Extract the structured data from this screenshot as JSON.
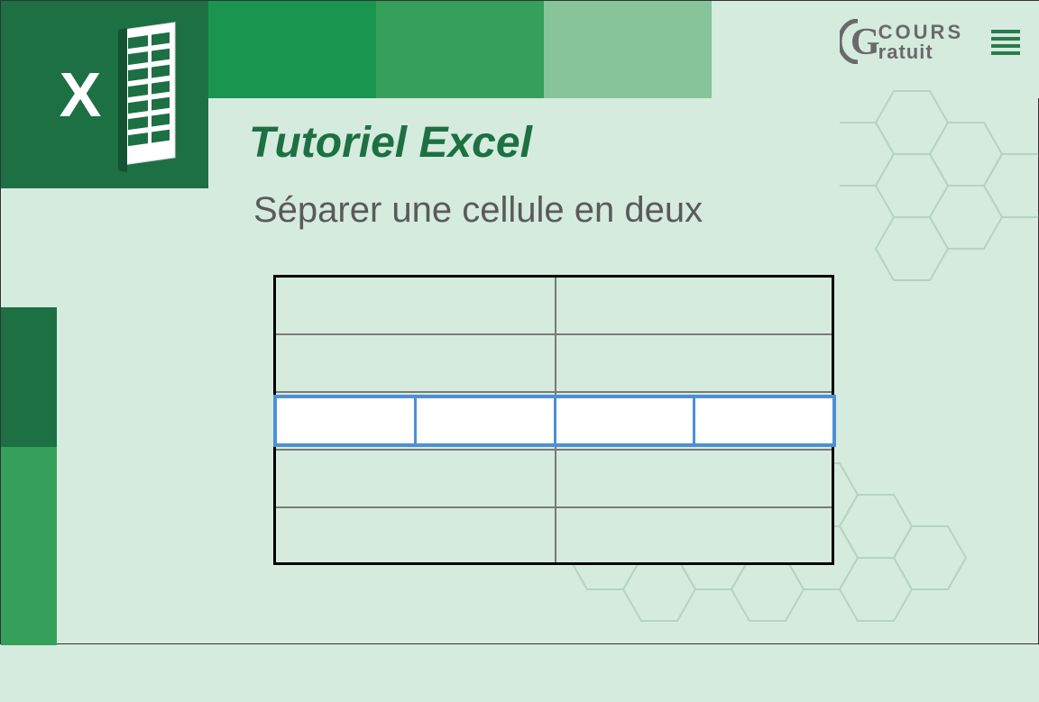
{
  "title": "Tutoriel Excel",
  "subtitle": "Séparer une cellule en deux",
  "logo": {
    "big_letter": "G",
    "line1": "COURS",
    "line2": "ratuit"
  },
  "excel_icon_letter": "X",
  "colors": {
    "dark_green": "#1d7044",
    "mid_green": "#1a9550",
    "light_green": "#36a05b",
    "pale_green": "#87c49a",
    "bg": "#d5ebde",
    "selection_blue": "#4f8fd6"
  }
}
